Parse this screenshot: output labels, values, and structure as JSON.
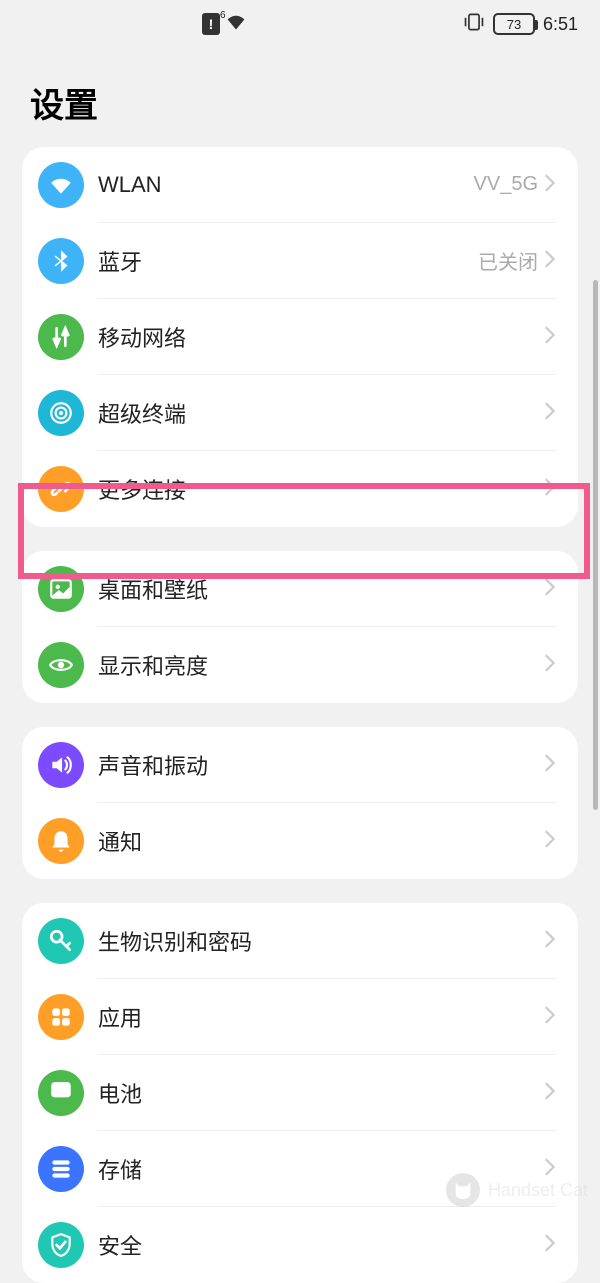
{
  "status_bar": {
    "wifi_indicator": "6",
    "battery_percent": "73",
    "time": "6:51"
  },
  "page_title": "设置",
  "groups": [
    {
      "items": [
        {
          "id": "wlan",
          "label": "WLAN",
          "value": "VV_5G",
          "icon": "wifi-icon",
          "color": "c-blue1"
        },
        {
          "id": "bluetooth",
          "label": "蓝牙",
          "value": "已关闭",
          "icon": "bluetooth-icon",
          "color": "c-blue2"
        },
        {
          "id": "mobile-network",
          "label": "移动网络",
          "value": "",
          "icon": "mobile-data-icon",
          "color": "c-green1"
        },
        {
          "id": "super-device",
          "label": "超级终端",
          "value": "",
          "icon": "radar-icon",
          "color": "c-teal"
        },
        {
          "id": "more-connections",
          "label": "更多连接",
          "value": "",
          "icon": "link-icon",
          "color": "c-orange1"
        }
      ]
    },
    {
      "items": [
        {
          "id": "home-wallpaper",
          "label": "桌面和壁纸",
          "value": "",
          "icon": "image-icon",
          "color": "c-green2",
          "highlighted": true
        },
        {
          "id": "display-brightness",
          "label": "显示和亮度",
          "value": "",
          "icon": "eye-icon",
          "color": "c-green3"
        }
      ]
    },
    {
      "items": [
        {
          "id": "sound-vibration",
          "label": "声音和振动",
          "value": "",
          "icon": "volume-icon",
          "color": "c-purple"
        },
        {
          "id": "notifications",
          "label": "通知",
          "value": "",
          "icon": "bell-icon",
          "color": "c-orange2"
        }
      ]
    },
    {
      "items": [
        {
          "id": "biometrics-password",
          "label": "生物识别和密码",
          "value": "",
          "icon": "key-icon",
          "color": "c-teal2"
        },
        {
          "id": "apps",
          "label": "应用",
          "value": "",
          "icon": "apps-icon",
          "color": "c-orange3"
        },
        {
          "id": "battery",
          "label": "电池",
          "value": "",
          "icon": "battery-icon",
          "color": "c-green4"
        },
        {
          "id": "storage",
          "label": "存储",
          "value": "",
          "icon": "storage-icon",
          "color": "c-blue3"
        },
        {
          "id": "security",
          "label": "安全",
          "value": "",
          "icon": "shield-icon",
          "color": "c-teal3"
        }
      ]
    }
  ],
  "watermark": "Handset Cat"
}
